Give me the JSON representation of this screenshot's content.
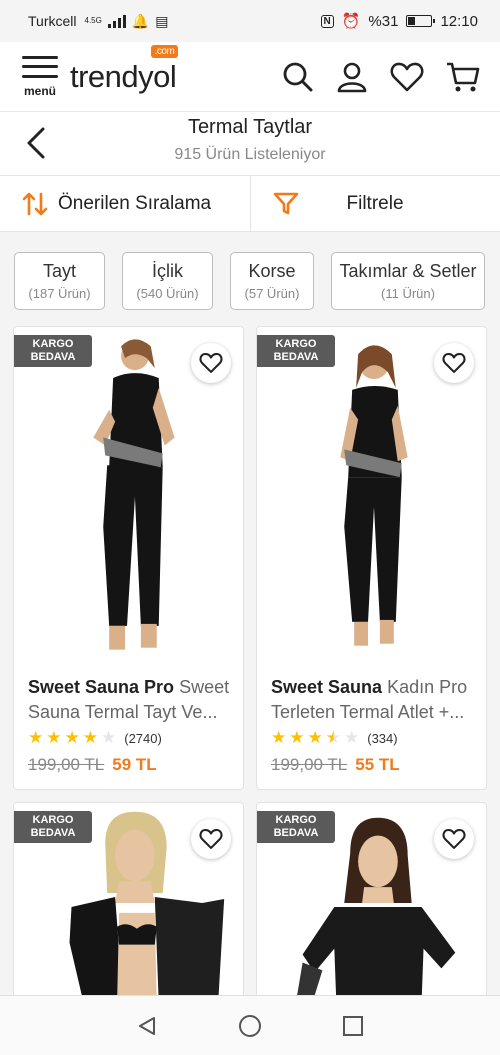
{
  "statusbar": {
    "carrier": "Turkcell",
    "network": "4.5G",
    "battery": "%31",
    "battery_level": 0.31,
    "time": "12:10"
  },
  "header": {
    "menu_label": "menü",
    "logo_text": "trendyol",
    "logo_tag": ".com",
    "icons": [
      "search-icon",
      "user-icon",
      "heart-icon",
      "cart-icon"
    ]
  },
  "page": {
    "title": "Termal Taytlar",
    "subtitle": "915 Ürün Listeleniyor"
  },
  "sortbar": {
    "sort_label": "Önerilen Sıralama",
    "filter_label": "Filtrele"
  },
  "chips": [
    {
      "name": "Tayt",
      "count": "(187 Ürün)"
    },
    {
      "name": "İçlik",
      "count": "(540 Ürün)"
    },
    {
      "name": "Korse",
      "count": "(57 Ürün)"
    },
    {
      "name": "Takımlar & Setler",
      "count": "(11 Ürün)"
    }
  ],
  "products": [
    {
      "badge": "KARGO\nBEDAVA",
      "brand": "Sweet Sauna Pro",
      "desc": "Sweet Sauna Termal Tayt Ve...",
      "rating": 4,
      "reviews": "(2740)",
      "old_price": "199,00 TL",
      "new_price": "59 TL"
    },
    {
      "badge": "KARGO\nBEDAVA",
      "brand": "Sweet Sauna",
      "desc": "Kadın Pro Terleten Termal Atlet +...",
      "rating": 3.5,
      "reviews": "(334)",
      "old_price": "199,00 TL",
      "new_price": "55 TL"
    },
    {
      "badge": "KARGO\nBEDAVA"
    },
    {
      "badge": "KARGO\nBEDAVA"
    }
  ],
  "colors": {
    "accent": "#f27a1a",
    "star": "#ffc000",
    "star_empty": "#e6e6e6",
    "badge_bg": "#5a5a5a"
  }
}
